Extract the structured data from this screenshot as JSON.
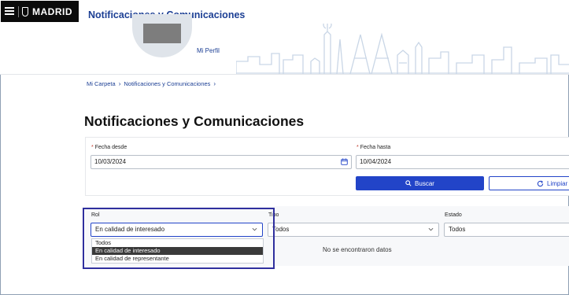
{
  "header": {
    "brand": "MADRID",
    "app_title": "Notificaciones y Comunicaciones",
    "profile_link": "Mi Perfil"
  },
  "breadcrumb": [
    "Mi Carpeta",
    "Notificaciones y Comunicaciones"
  ],
  "page_title": "Notificaciones y Comunicaciones",
  "filters": {
    "fecha_desde_label": "Fecha desde",
    "fecha_desde_value": "10/03/2024",
    "fecha_hasta_label": "Fecha hasta",
    "fecha_hasta_value": "10/04/2024",
    "buscar_label": "Buscar",
    "limpiar_label": "Limpiar"
  },
  "results": {
    "rol_label": "Rol",
    "rol_value": "En calidad de interesado",
    "tipo_label": "Tipo",
    "tipo_value": "Todos",
    "estado_label": "Estado",
    "estado_value": "Todos",
    "empty_message": "No se encontraron datos",
    "rol_options": [
      "Todos",
      "En calidad de interesado",
      "En calidad de representante"
    ],
    "rol_selected_index": 1
  },
  "colors": {
    "brand_blue": "#1c3f94",
    "primary_button": "#2244c8",
    "highlight_border": "#2f2f9e"
  }
}
